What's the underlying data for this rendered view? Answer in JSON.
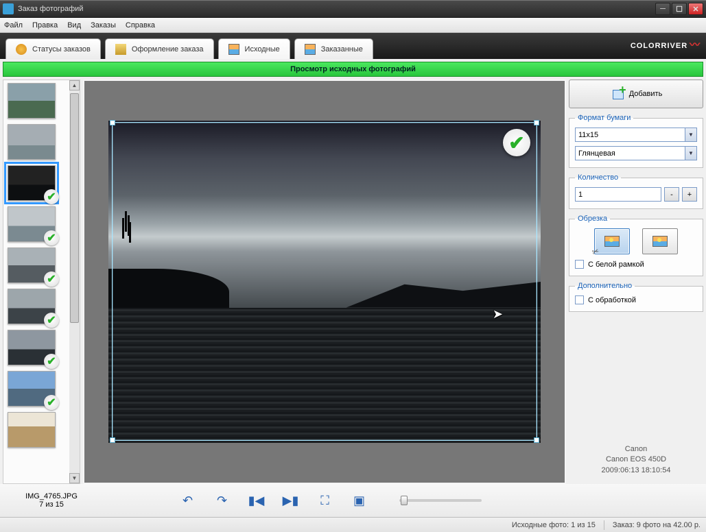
{
  "window_title": "Заказ фотографий",
  "menu": [
    "Файл",
    "Правка",
    "Вид",
    "Заказы",
    "Справка"
  ],
  "toolbar_tabs": [
    {
      "label": "Статусы заказов",
      "icon": "status-icon"
    },
    {
      "label": "Оформление заказа",
      "icon": "order-icon"
    },
    {
      "label": "Исходные",
      "icon": "source-icon",
      "active": true
    },
    {
      "label": "Заказанные",
      "icon": "ordered-icon"
    }
  ],
  "brand": "COLORRIVER",
  "green_banner": "Просмотр исходных фотографий",
  "thumbnails": [
    {
      "checked": false,
      "selected": false,
      "variant": "th1"
    },
    {
      "checked": false,
      "selected": false,
      "variant": "th2"
    },
    {
      "checked": true,
      "selected": true,
      "variant": "th3"
    },
    {
      "checked": true,
      "selected": false,
      "variant": "th4"
    },
    {
      "checked": true,
      "selected": false,
      "variant": "th5"
    },
    {
      "checked": true,
      "selected": false,
      "variant": "th6"
    },
    {
      "checked": true,
      "selected": false,
      "variant": "th7"
    },
    {
      "checked": true,
      "selected": false,
      "variant": "th8"
    },
    {
      "checked": false,
      "selected": false,
      "variant": "th9"
    }
  ],
  "current_file": "IMG_4765.JPG",
  "current_index": "7 из 15",
  "add_button": "Добавить",
  "sections": {
    "paper_format": {
      "legend": "Формат бумаги",
      "size": "11x15",
      "finish": "Глянцевая"
    },
    "quantity": {
      "legend": "Количество",
      "value": "1",
      "minus": "-",
      "plus": "+"
    },
    "crop": {
      "legend": "Обрезка",
      "white_frame": "С белой рамкой"
    },
    "extra": {
      "legend": "Дополнительно",
      "processing": "С обработкой"
    }
  },
  "camera": {
    "make": "Canon",
    "model": "Canon EOS 450D",
    "datetime": "2009:06:13 18:10:54"
  },
  "status": {
    "source_count": "Исходные фото:  1 из 15",
    "order": "Заказ: 9 фото на 42.00 р."
  }
}
